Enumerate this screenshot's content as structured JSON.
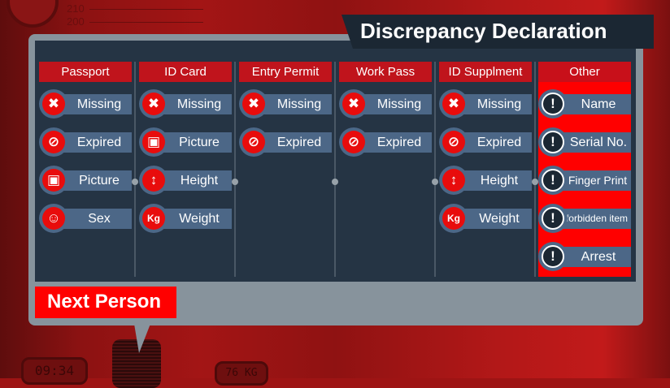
{
  "title": "Discrepancy Declaration",
  "background": {
    "ruler": [
      "210",
      "200"
    ],
    "clock_display": "09:34",
    "scale_display": "76 KG"
  },
  "columns": [
    {
      "header": "Passport",
      "items": [
        {
          "icon": "x-icon",
          "label": "Missing"
        },
        {
          "icon": "prohibited-icon",
          "label": "Expired"
        },
        {
          "icon": "portrait-icon",
          "label": "Picture"
        },
        {
          "icon": "person-icon",
          "label": "Sex"
        }
      ]
    },
    {
      "header": "ID Card",
      "items": [
        {
          "icon": "x-icon",
          "label": "Missing"
        },
        {
          "icon": "portrait-icon",
          "label": "Picture"
        },
        {
          "icon": "height-icon",
          "label": "Height"
        },
        {
          "icon": "weight-icon",
          "label": "Weight"
        }
      ]
    },
    {
      "header": "Entry Permit",
      "items": [
        {
          "icon": "x-icon",
          "label": "Missing"
        },
        {
          "icon": "prohibited-icon",
          "label": "Expired"
        }
      ]
    },
    {
      "header": "Work Pass",
      "items": [
        {
          "icon": "x-icon",
          "label": "Missing"
        },
        {
          "icon": "prohibited-icon",
          "label": "Expired"
        }
      ]
    },
    {
      "header": "ID Supplment",
      "items": [
        {
          "icon": "x-icon",
          "label": "Missing"
        },
        {
          "icon": "prohibited-icon",
          "label": "Expired"
        },
        {
          "icon": "height-icon",
          "label": "Height"
        },
        {
          "icon": "weight-icon",
          "label": "Weight"
        }
      ]
    },
    {
      "header": "Other",
      "highlighted": true,
      "items": [
        {
          "icon": "exclamation-icon",
          "label": "Name"
        },
        {
          "icon": "exclamation-icon",
          "label": "Serial No."
        },
        {
          "icon": "exclamation-icon",
          "label": "Finger Print"
        },
        {
          "icon": "exclamation-icon",
          "label": "forbidden item"
        },
        {
          "icon": "exclamation-icon",
          "label": "Arrest"
        }
      ]
    }
  ],
  "next_button": "Next Person",
  "colors": {
    "accent_red": "#ff0000",
    "header_red": "#c0141c",
    "panel_dark": "#253444",
    "label_blue": "#4c6787",
    "panel_gray": "#87939c"
  }
}
